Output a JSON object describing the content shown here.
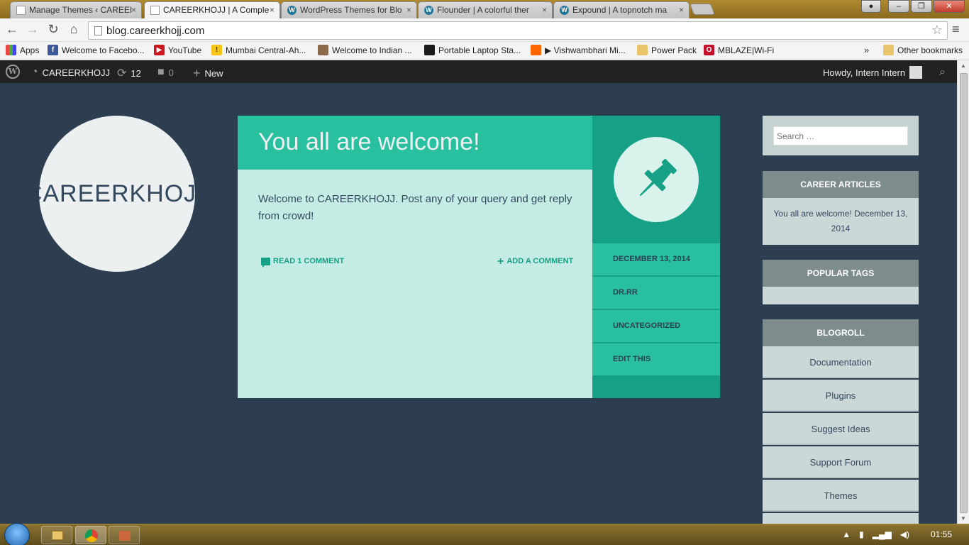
{
  "browser": {
    "tabs": [
      {
        "title": "Manage Themes ‹ CAREEI",
        "icon": "document"
      },
      {
        "title": "CAREERKHOJJ | A Comple",
        "icon": "document"
      },
      {
        "title": "WordPress Themes for Blo",
        "icon": "wordpress"
      },
      {
        "title": "Flounder | A colorful ther",
        "icon": "wordpress"
      },
      {
        "title": "Expound | A topnotch ma",
        "icon": "wordpress"
      }
    ],
    "tab_close_glyph": "×",
    "url": "blog.careerkhojj.com",
    "bookmarks": [
      {
        "label": "Apps"
      },
      {
        "label": "Welcome to Facebo..."
      },
      {
        "label": "YouTube"
      },
      {
        "label": "Mumbai Central-Ah..."
      },
      {
        "label": "Welcome to Indian ..."
      },
      {
        "label": "Portable Laptop Sta..."
      },
      {
        "label": "▶ Vishwambhari Mi..."
      },
      {
        "label": "Power Pack"
      },
      {
        "label": "MBLAZE|Wi-Fi"
      }
    ],
    "bookmarks_overflow": "»",
    "other_bookmarks": "Other bookmarks"
  },
  "admin_bar": {
    "site_name": "CAREERKHOJJ",
    "updates_count": "12",
    "comments_count": "0",
    "new_label": "New",
    "howdy": "Howdy, Intern Intern"
  },
  "site": {
    "logo_text": "CAREERKHOJJ"
  },
  "post": {
    "title": "You all are welcome!",
    "body": "Welcome to CAREERKHOJJ. Post any of your query and get reply from crowd!",
    "read_comments": "READ 1 COMMENT",
    "add_comment": "ADD A COMMENT",
    "meta": {
      "date": "DECEMBER 13, 2014",
      "author": "DR.RR",
      "category": "UNCATEGORIZED",
      "edit": "EDIT THIS"
    }
  },
  "sidebar": {
    "search_placeholder": "Search …",
    "career_articles": {
      "title": "CAREER ARTICLES",
      "item": "You all are welcome! December 13, 2014"
    },
    "popular_tags": {
      "title": "POPULAR TAGS"
    },
    "blogroll": {
      "title": "BLOGROLL",
      "items": [
        "Documentation",
        "Plugins",
        "Suggest Ideas",
        "Support Forum",
        "Themes"
      ]
    }
  },
  "taskbar": {
    "clock": "01:55"
  },
  "colors": {
    "page_bg": "#2c3e50",
    "accent": "#29c0a0",
    "accent_dark": "#16a085",
    "post_bg": "#c5ece4",
    "widget_title_bg": "#7f8c8d"
  }
}
